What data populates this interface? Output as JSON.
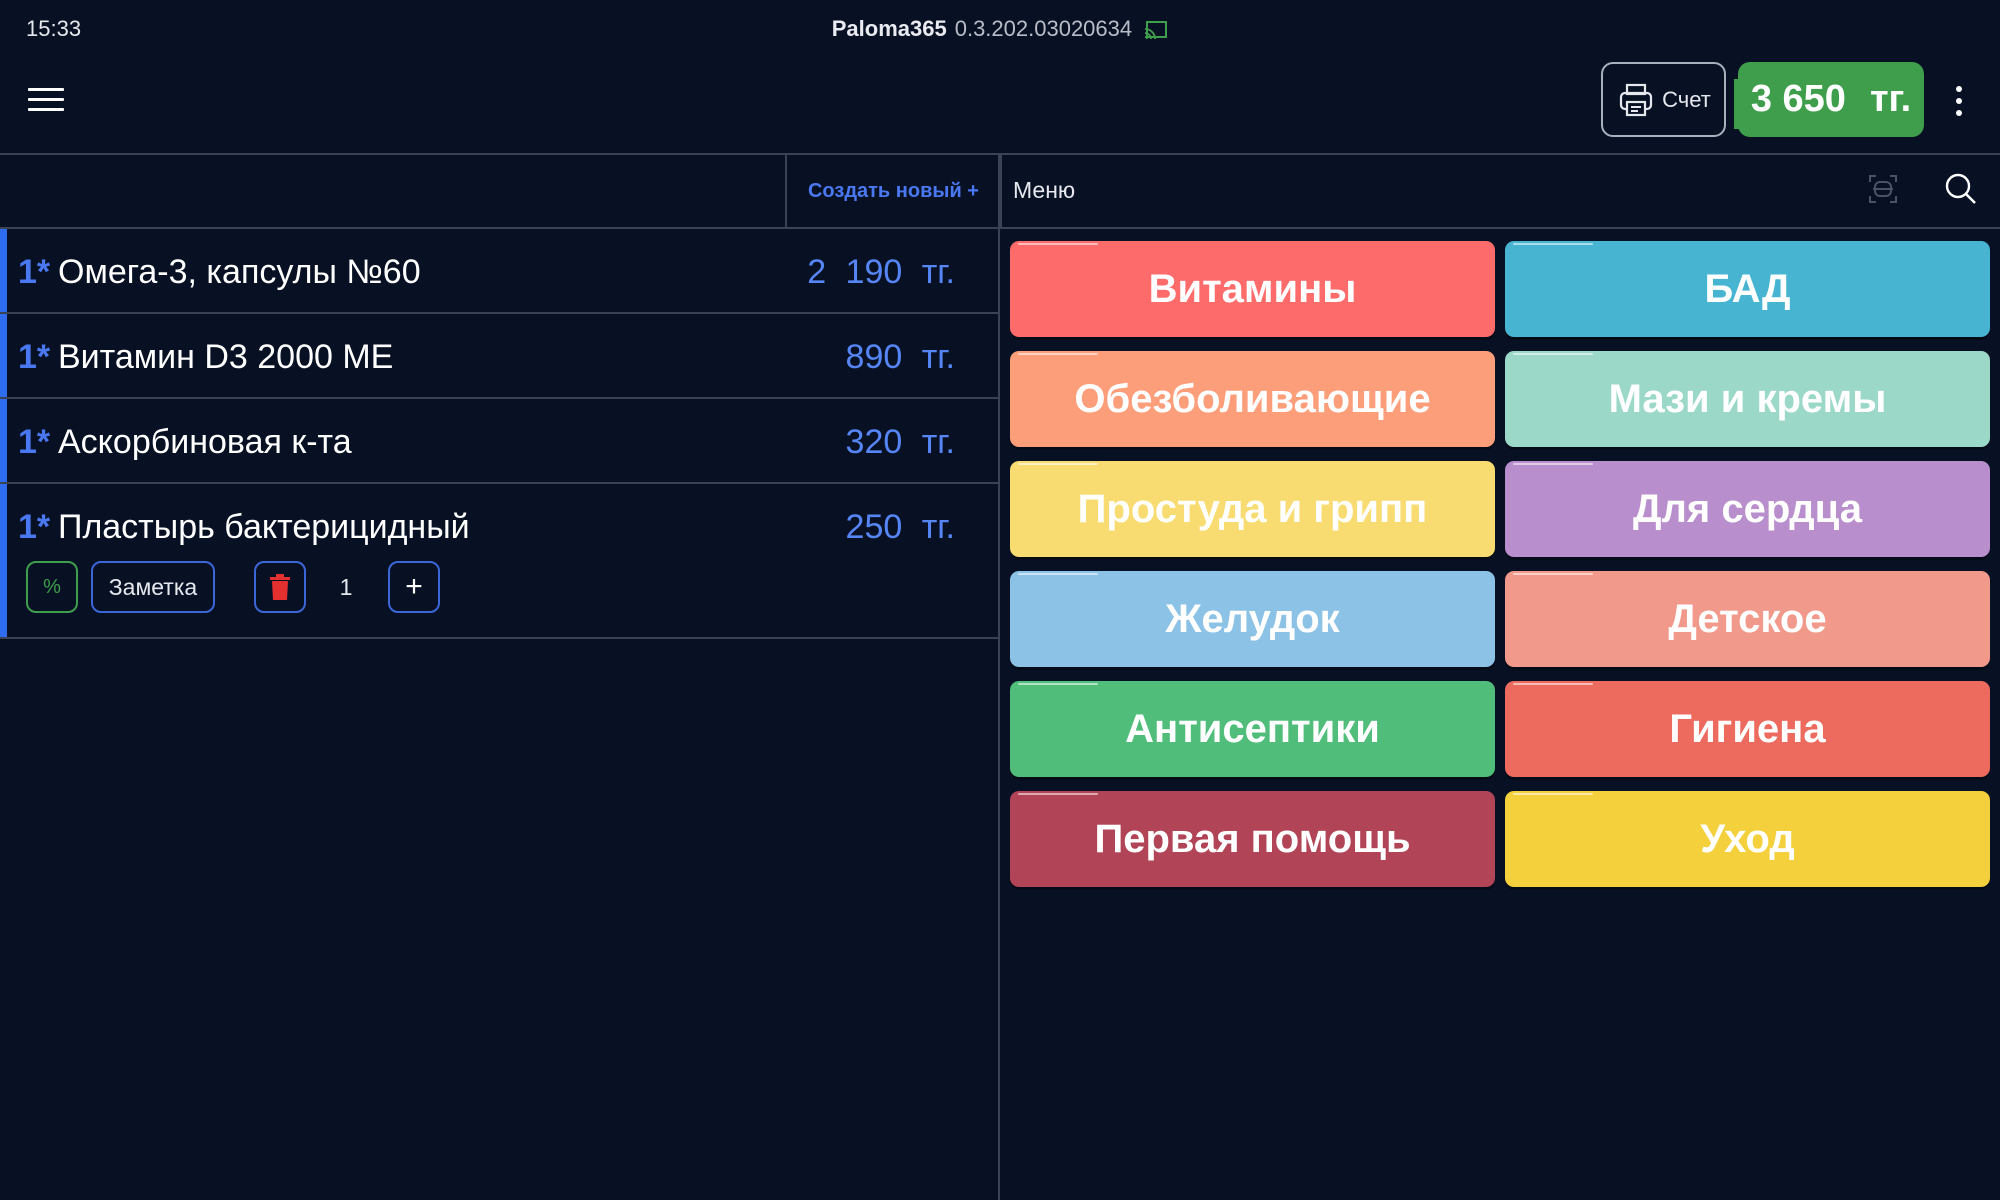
{
  "status_bar": {
    "time": "15:33",
    "app_name": "Paloma365",
    "version": "0.3.202.03020634",
    "cast_icon": "cast-icon"
  },
  "header": {
    "menu_icon": "hamburger-menu-icon",
    "bill_label": "Счет",
    "bill_icon": "printer-icon",
    "total_amount": "3 650",
    "total_currency": "тг.",
    "total_color": "#3f9e4b",
    "more_icon": "more-vertical-icon"
  },
  "order": {
    "create_new_label": "Создать новый +",
    "items": [
      {
        "qty": "1*",
        "name": "Омега-3, капсулы №60",
        "price": "2 190 тг."
      },
      {
        "qty": "1*",
        "name": "Витамин D3 2000 МЕ",
        "price": "890 тг."
      },
      {
        "qty": "1*",
        "name": "Аскорбиновая к-та",
        "price": "320 тг."
      },
      {
        "qty": "1*",
        "name": "Пластырь бактерицидный",
        "price": "250 тг."
      }
    ],
    "selected_controls": {
      "discount_label": "%",
      "note_label": "Заметка",
      "delete_icon": "trash-icon",
      "quantity": "1",
      "plus_label": "+"
    }
  },
  "menu_panel": {
    "title": "Меню",
    "scan_icon": "barcode-scan-icon",
    "search_icon": "search-icon",
    "categories": [
      {
        "label": "Витамины",
        "color": "#fe6b6b"
      },
      {
        "label": "БАД",
        "color": "#47b5d1"
      },
      {
        "label": "Обезболивающие",
        "color": "#fd9e7b"
      },
      {
        "label": "Мази и кремы",
        "color": "#9bd8c8"
      },
      {
        "label": "Простуда и грипп",
        "color": "#f8dc71"
      },
      {
        "label": "Для сердца",
        "color": "#b88ecd"
      },
      {
        "label": "Желудок",
        "color": "#8cc2e6"
      },
      {
        "label": "Детское",
        "color": "#f19a8b"
      },
      {
        "label": "Антисептики",
        "color": "#50be7a"
      },
      {
        "label": "Гигиена",
        "color": "#ec6b5e"
      },
      {
        "label": "Первая помощь",
        "color": "#b14457"
      },
      {
        "label": "Уход",
        "color": "#f4d03c"
      }
    ]
  }
}
